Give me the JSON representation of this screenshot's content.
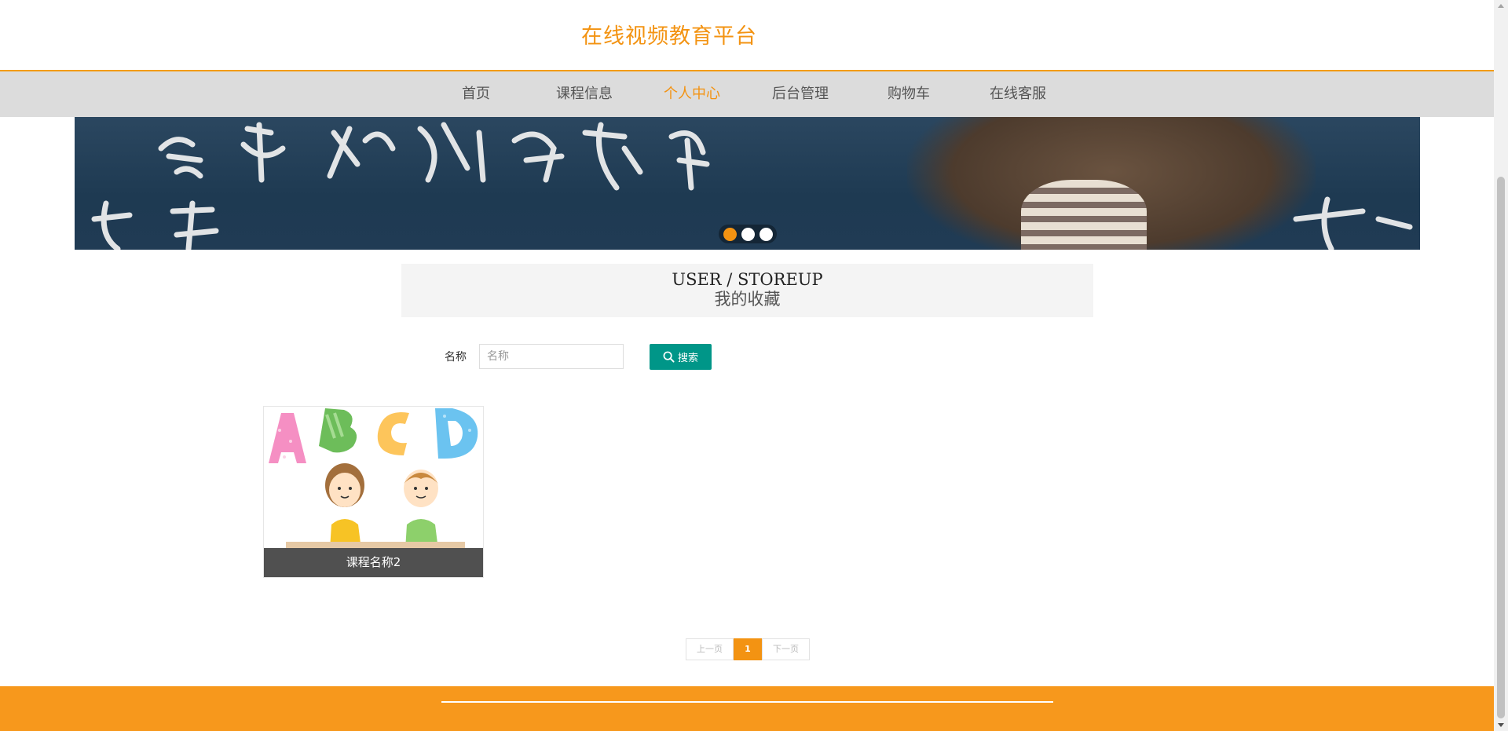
{
  "header": {
    "site_title": "在线视频教育平台"
  },
  "nav": {
    "items": [
      {
        "label": "首页",
        "active": false
      },
      {
        "label": "课程信息",
        "active": false
      },
      {
        "label": "个人中心",
        "active": true
      },
      {
        "label": "后台管理",
        "active": false
      },
      {
        "label": "购物车",
        "active": false
      },
      {
        "label": "在线客服",
        "active": false
      }
    ]
  },
  "banner": {
    "slide_count": 3,
    "active_slide": 1
  },
  "section": {
    "title_en": "USER / STOREUP",
    "title_cn": "我的收藏"
  },
  "search": {
    "label": "名称",
    "placeholder": "名称",
    "value": "",
    "button_label": "搜索"
  },
  "courses": [
    {
      "name": "课程名称2"
    }
  ],
  "pagination": {
    "prev_label": "上一页",
    "current_page": "1",
    "next_label": "下一页"
  },
  "colors": {
    "accent": "#f39312",
    "search_button": "#009688",
    "footer": "#f7981c",
    "nav_bg": "#dcdcdc"
  },
  "icons": {
    "search_button_icon": "search-icon"
  }
}
